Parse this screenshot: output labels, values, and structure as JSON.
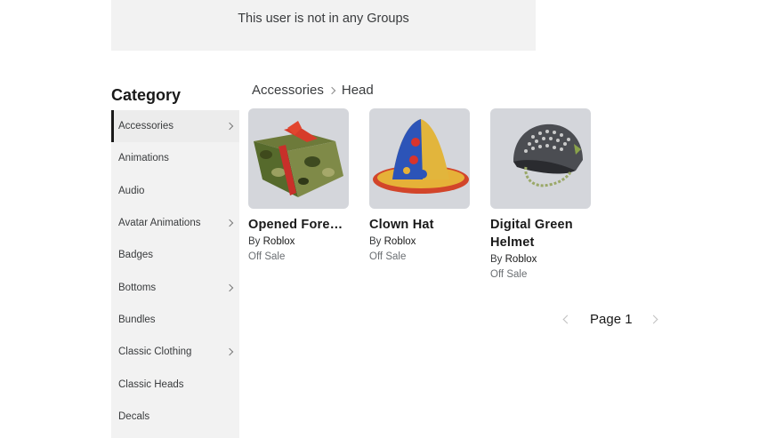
{
  "groups": {
    "empty_message": "This user is not in any Groups"
  },
  "category": {
    "title": "Category",
    "items": [
      {
        "label": "Accessories",
        "has_submenu": true,
        "active": true
      },
      {
        "label": "Animations",
        "has_submenu": false
      },
      {
        "label": "Audio",
        "has_submenu": false
      },
      {
        "label": "Avatar Animations",
        "has_submenu": true
      },
      {
        "label": "Badges",
        "has_submenu": false
      },
      {
        "label": "Bottoms",
        "has_submenu": true
      },
      {
        "label": "Bundles",
        "has_submenu": false
      },
      {
        "label": "Classic Clothing",
        "has_submenu": true
      },
      {
        "label": "Classic Heads",
        "has_submenu": false
      },
      {
        "label": "Decals",
        "has_submenu": false
      }
    ]
  },
  "breadcrumb": {
    "parent": "Accessories",
    "current": "Head"
  },
  "items": [
    {
      "name": "Opened Forest Cam...",
      "by": "By",
      "creator": "Roblox",
      "price": "Off Sale",
      "icon": "camo-gift-thumbnail"
    },
    {
      "name": "Clown Hat",
      "by": "By",
      "creator": "Roblox",
      "price": "Off Sale",
      "icon": "clown-hat-thumbnail"
    },
    {
      "name": "Digital Green Helmet",
      "by": "By",
      "creator": "Roblox",
      "price": "Off Sale",
      "icon": "helmet-thumbnail"
    }
  ],
  "pager": {
    "label": "Page 1"
  }
}
